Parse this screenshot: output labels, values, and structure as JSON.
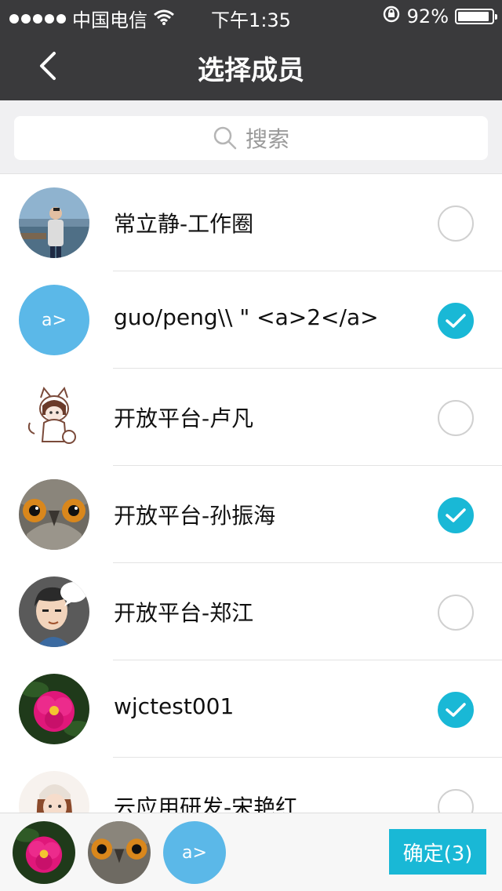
{
  "status_bar": {
    "carrier": "中国电信",
    "time": "下午1:35",
    "battery": "92%",
    "battery_level": 0.92
  },
  "nav": {
    "title": "选择成员",
    "back_icon": "chevron-left-icon"
  },
  "search": {
    "placeholder": "搜索",
    "icon": "search-icon"
  },
  "members": [
    {
      "name": "常立静-工作圈",
      "selected": false,
      "avatar": "photo-person-seaside"
    },
    {
      "name": "guo/peng\\\\ \" <a>2</a>",
      "selected": true,
      "avatar": "text",
      "avatar_text": "a>"
    },
    {
      "name": "开放平台-卢凡",
      "selected": false,
      "avatar": "sketch-cat-girl"
    },
    {
      "name": "开放平台-孙振海",
      "selected": true,
      "avatar": "photo-owl"
    },
    {
      "name": "开放平台-郑江",
      "selected": false,
      "avatar": "cartoon-boy"
    },
    {
      "name": "wjctest001",
      "selected": true,
      "avatar": "photo-pink-flower"
    },
    {
      "name": "云应用研发-宋艳红",
      "selected": false,
      "avatar": "cartoon-girl"
    }
  ],
  "selected_preview": [
    {
      "avatar": "photo-pink-flower"
    },
    {
      "avatar": "photo-owl"
    },
    {
      "avatar": "text",
      "avatar_text": "a>"
    }
  ],
  "confirm": {
    "label": "确定(3)"
  },
  "colors": {
    "header": "#3a3a3c",
    "accent": "#19b8d6",
    "text_avatar": "#5bb8e8"
  }
}
